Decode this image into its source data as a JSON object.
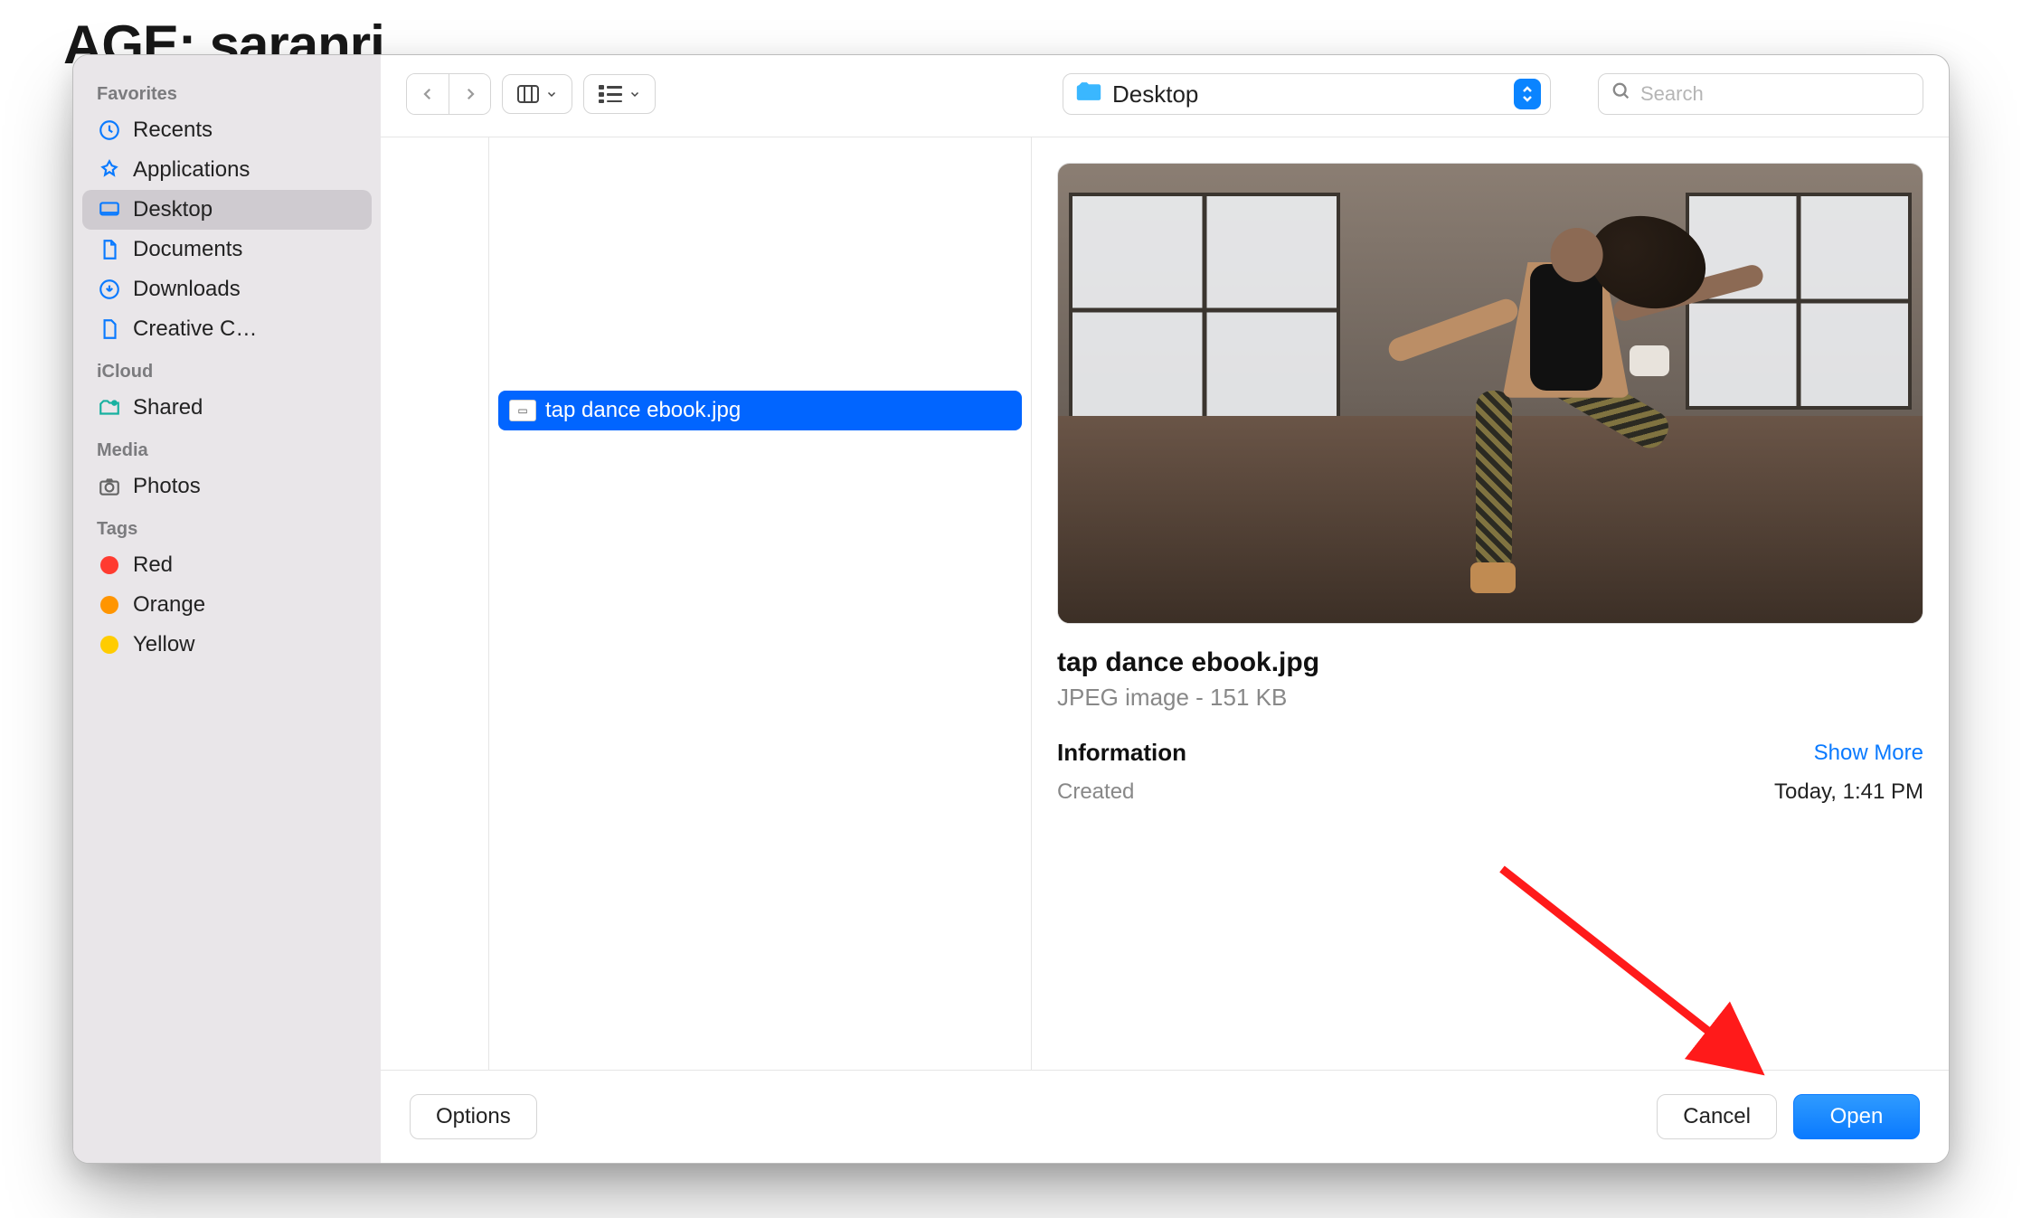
{
  "background_text": "AGE: saranri",
  "sidebar": {
    "sections": [
      {
        "heading": "Favorites",
        "items": [
          {
            "label": "Recents",
            "icon": "clock-icon",
            "selected": false
          },
          {
            "label": "Applications",
            "icon": "apps-icon",
            "selected": false
          },
          {
            "label": "Desktop",
            "icon": "desktop-icon",
            "selected": true
          },
          {
            "label": "Documents",
            "icon": "document-icon",
            "selected": false
          },
          {
            "label": "Downloads",
            "icon": "download-icon",
            "selected": false
          },
          {
            "label": "Creative C…",
            "icon": "file-icon",
            "selected": false
          }
        ]
      },
      {
        "heading": "iCloud",
        "items": [
          {
            "label": "Shared",
            "icon": "shared-folder-icon",
            "selected": false
          }
        ]
      },
      {
        "heading": "Media",
        "items": [
          {
            "label": "Photos",
            "icon": "camera-icon",
            "selected": false
          }
        ]
      },
      {
        "heading": "Tags",
        "items": [
          {
            "label": "Red",
            "icon": "tag-dot",
            "color": "#ff3b30"
          },
          {
            "label": "Orange",
            "icon": "tag-dot",
            "color": "#ff9500"
          },
          {
            "label": "Yellow",
            "icon": "tag-dot",
            "color": "#ffcc00"
          }
        ]
      }
    ]
  },
  "toolbar": {
    "location_label": "Desktop",
    "search_placeholder": "Search"
  },
  "files": {
    "list": [
      {
        "name": "tap dance ebook.jpg",
        "selected": true
      }
    ]
  },
  "preview": {
    "filename": "tap dance ebook.jpg",
    "subtype": "JPEG image - 151 KB",
    "info_heading": "Information",
    "show_more_label": "Show More",
    "rows": [
      {
        "key": "Created",
        "value": "Today, 1:41 PM"
      }
    ]
  },
  "footer": {
    "options_label": "Options",
    "cancel_label": "Cancel",
    "open_label": "Open"
  },
  "colors": {
    "accent": "#0a7aff",
    "sidebar_bg": "#e9e6e9",
    "selection": "#0165ff"
  }
}
